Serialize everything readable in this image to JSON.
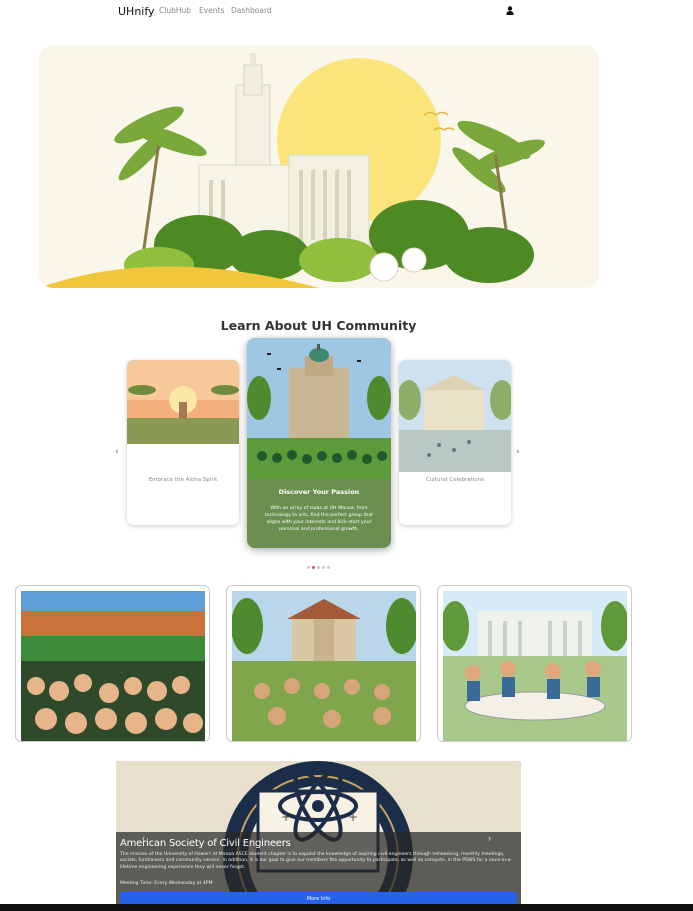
{
  "nav": {
    "brand": "UHnify",
    "links": [
      "ClubHub",
      "Events",
      "Dashboard"
    ],
    "user_icon": "user-icon"
  },
  "hero": {
    "image": "hero-illustration"
  },
  "section": {
    "title": "Learn About UH Community"
  },
  "carousel": {
    "left_card": {
      "caption": "Embrace the Aloha Spirit"
    },
    "center_card": {
      "title": "Discover Your Passion",
      "body": "With an array of clubs at UH Manoa, from technology to arts, find the perfect group that aligns with your interests and kick-start your personal and professional growth."
    },
    "right_card": {
      "caption": "Cultural Celebrations"
    },
    "prev_icon": "chevron-left-icon",
    "next_icon": "chevron-right-icon",
    "dots_count": 5,
    "active_dot": 1
  },
  "gallery": [
    "stadium-crowd-image",
    "campus-lawn-image",
    "students-study-image"
  ],
  "club": {
    "name": "American Society of Civil Engineers",
    "description": "The mission of the University of Hawaiʻi at Manoa ASCE student chapter is to expand the knowledge of aspiring civil engineers through networking, monthly meetings, socials, fundraisers and community service. In addition, it is our goal to give our members the opportunity to participate, as well as compete, in the PSWS for a once-in-a-lifetime engineering experience they will never forget.",
    "meeting": "Meeting Time: Every Wednesday at 4PM",
    "button": "More Info"
  },
  "colors": {
    "accent": "#2563eb",
    "card_green": "#6a8f4f",
    "dot_active": "#e05252"
  }
}
